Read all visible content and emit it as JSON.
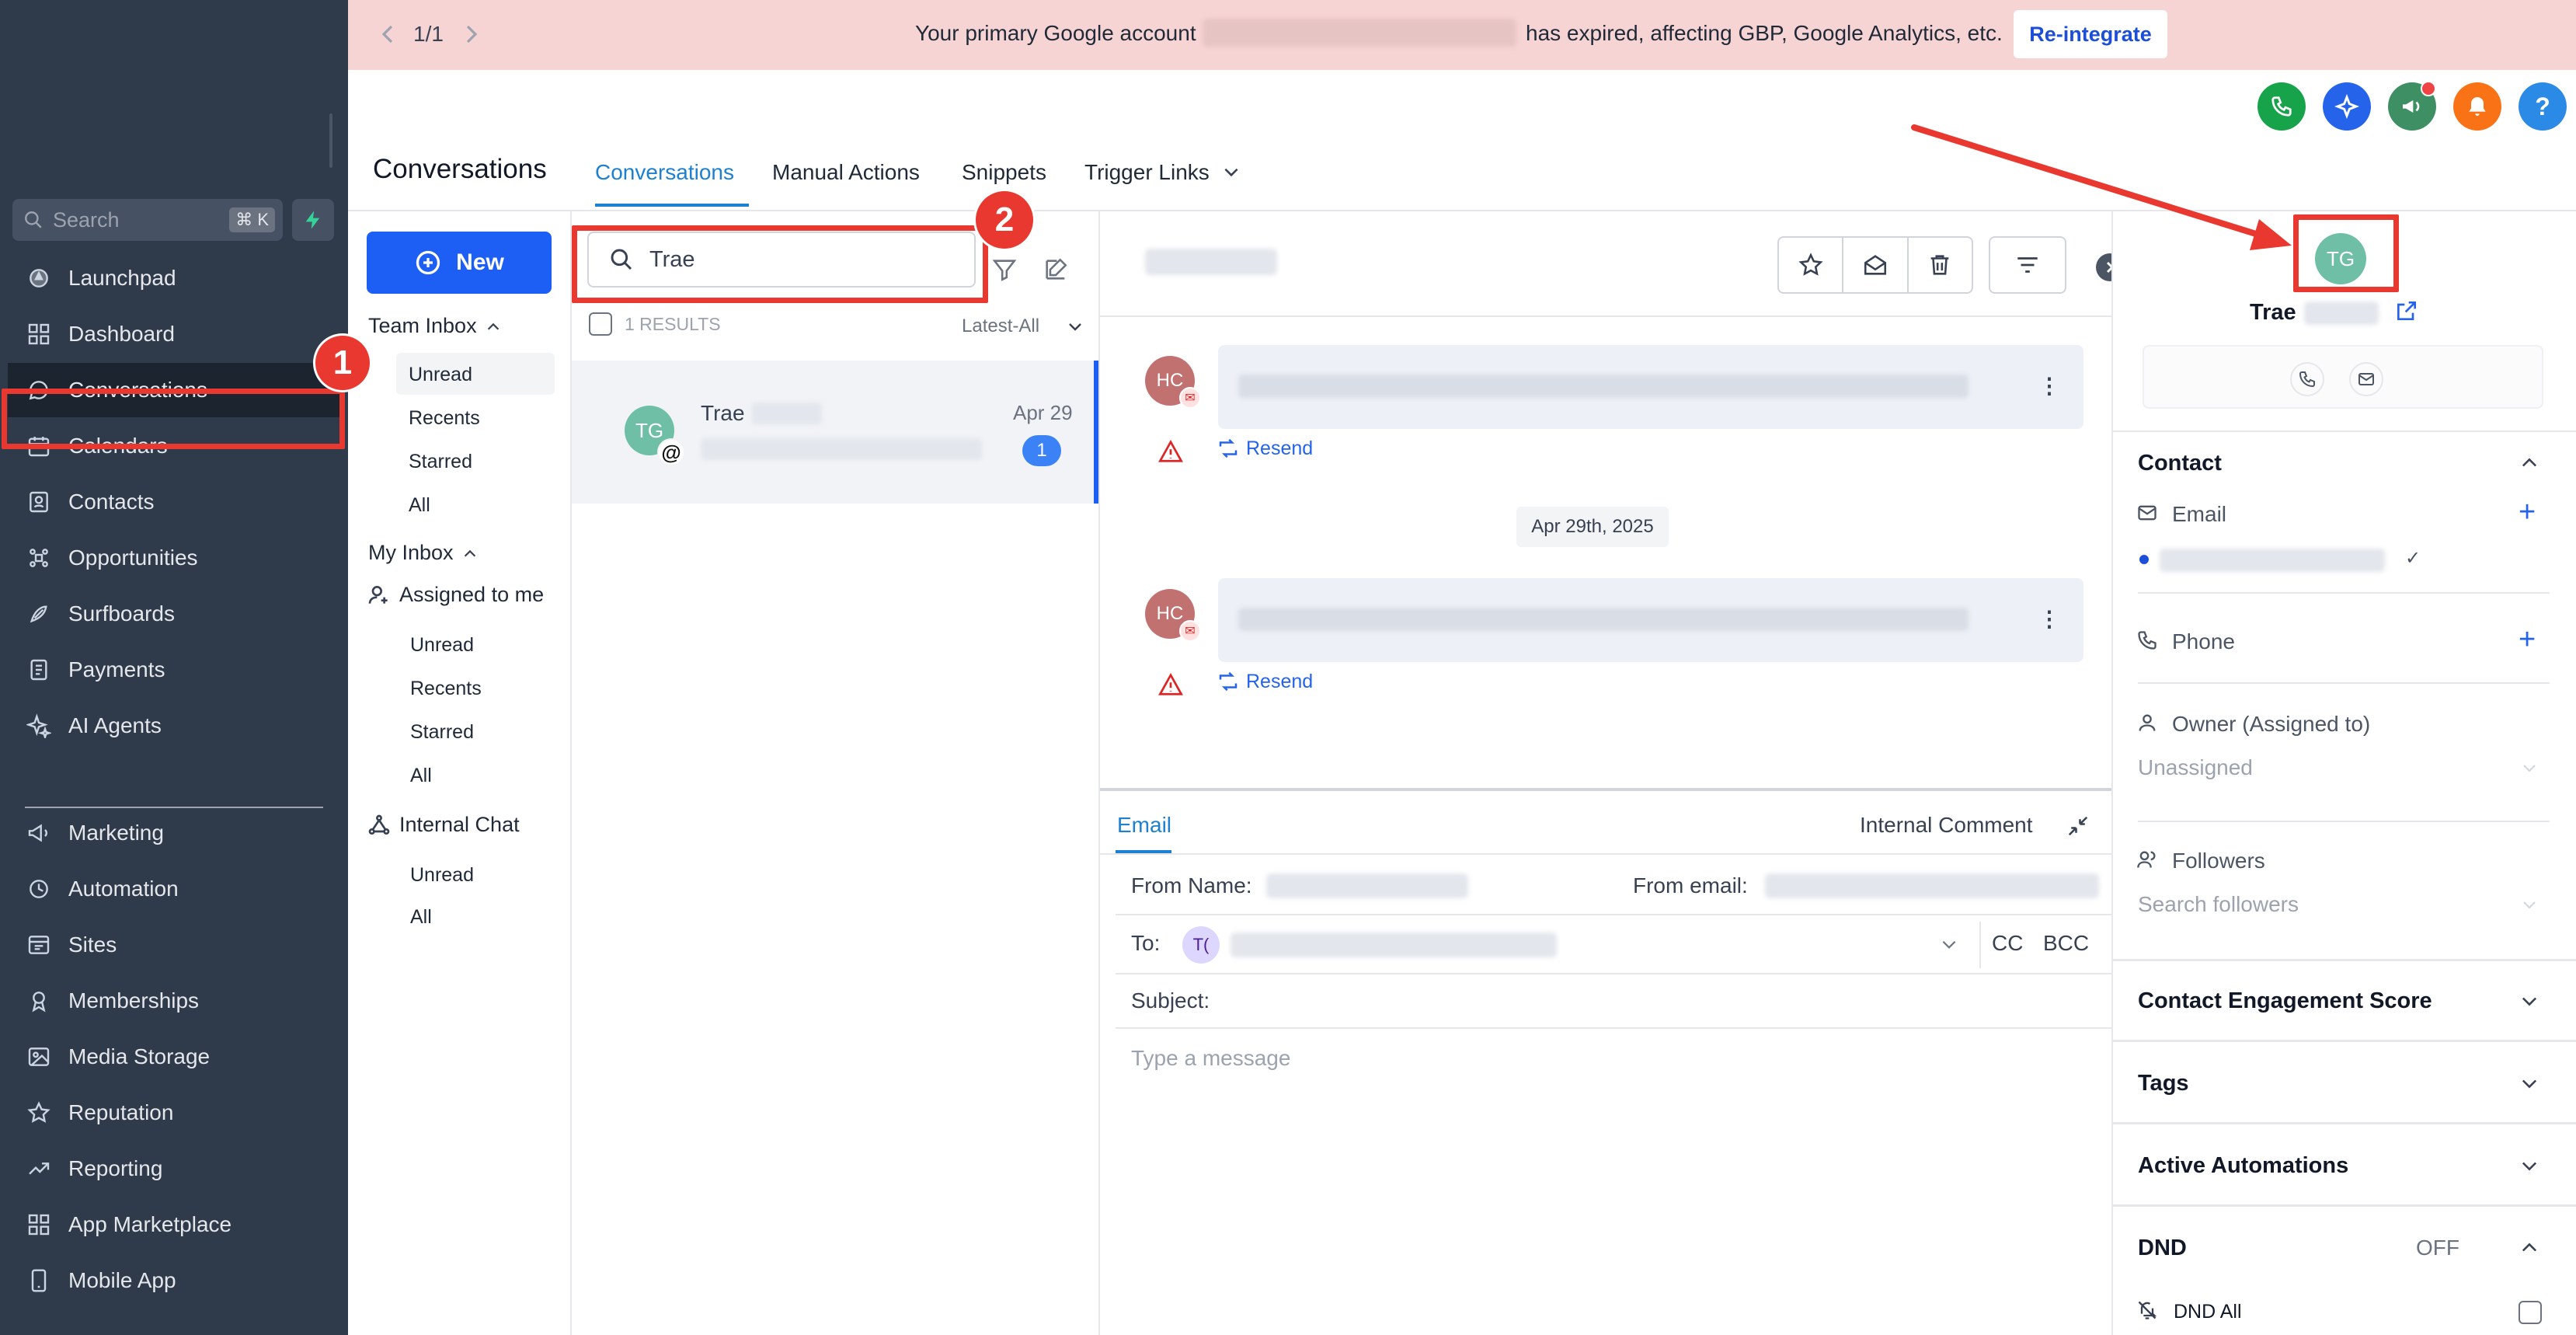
{
  "banner": {
    "pager": "1/1",
    "message_before": "Your primary Google account",
    "message_after": "has expired, affecting GBP, Google Analytics, etc.",
    "reintegrate_label": "Re-integrate"
  },
  "sidebar": {
    "search_placeholder": "Search",
    "search_shortcut": "⌘ K",
    "items": [
      {
        "label": "Launchpad",
        "icon": "rocket-icon"
      },
      {
        "label": "Dashboard",
        "icon": "dashboard-icon"
      },
      {
        "label": "Conversations",
        "icon": "chat-icon"
      },
      {
        "label": "Calendars",
        "icon": "calendar-icon"
      },
      {
        "label": "Contacts",
        "icon": "contacts-icon"
      },
      {
        "label": "Opportunities",
        "icon": "opportunities-icon"
      },
      {
        "label": "Surfboards",
        "icon": "surfboard-icon"
      },
      {
        "label": "Payments",
        "icon": "payments-icon"
      },
      {
        "label": "AI Agents",
        "icon": "sparkle-icon"
      },
      {
        "label": "Marketing",
        "icon": "marketing-icon"
      },
      {
        "label": "Automation",
        "icon": "automation-icon"
      },
      {
        "label": "Sites",
        "icon": "sites-icon"
      },
      {
        "label": "Memberships",
        "icon": "membership-icon"
      },
      {
        "label": "Media Storage",
        "icon": "media-icon"
      },
      {
        "label": "Reputation",
        "icon": "star-icon"
      },
      {
        "label": "Reporting",
        "icon": "reporting-icon"
      },
      {
        "label": "App Marketplace",
        "icon": "apps-icon"
      },
      {
        "label": "Mobile App",
        "icon": "mobile-icon"
      }
    ]
  },
  "header": {
    "title": "Conversations",
    "tabs": [
      "Conversations",
      "Manual Actions",
      "Snippets",
      "Trigger Links"
    ]
  },
  "inbox": {
    "new_label": "New",
    "team_inbox": "Team Inbox",
    "team_items": [
      "Unread",
      "Recents",
      "Starred",
      "All"
    ],
    "my_inbox": "My Inbox",
    "assigned_to_me": "Assigned to me",
    "my_items": [
      "Unread",
      "Recents",
      "Starred",
      "All"
    ],
    "internal_chat": "Internal Chat",
    "chat_items": [
      "Unread",
      "All"
    ]
  },
  "list": {
    "search_value": "Trae",
    "results": "1 RESULTS",
    "sort": "Latest-All",
    "item": {
      "initials": "TG",
      "name": "Trae",
      "date": "Apr 29",
      "unread": "1"
    }
  },
  "thread": {
    "messages": [
      {
        "initials": "HC",
        "resend": "Resend"
      },
      {
        "initials": "HC",
        "resend": "Resend"
      }
    ],
    "date_divider": "Apr 29th, 2025"
  },
  "composer": {
    "tab_email": "Email",
    "tab_internal": "Internal Comment",
    "from_name_label": "From Name:",
    "from_email_label": "From email:",
    "to_label": "To:",
    "to_chip": "T(",
    "cc": "CC",
    "bcc": "BCC",
    "subject_label": "Subject:",
    "message_placeholder": "Type a message"
  },
  "contact": {
    "initials": "TG",
    "name": "Trae",
    "section_contact": "Contact",
    "email_label": "Email",
    "phone_label": "Phone",
    "owner_label": "Owner (Assigned to)",
    "owner_value": "Unassigned",
    "followers_label": "Followers",
    "followers_placeholder": "Search followers",
    "engagement": "Contact Engagement Score",
    "tags": "Tags",
    "automations": "Active Automations",
    "dnd": "DND",
    "dnd_state": "OFF",
    "dnd_all": "DND All"
  },
  "annotations": {
    "step1": "1",
    "step2": "2"
  },
  "colors": {
    "sidebar": "#2f3a4b",
    "accent": "#1d5ff5",
    "annotation_red": "#e8382f",
    "banner": "#f7d4d4"
  }
}
